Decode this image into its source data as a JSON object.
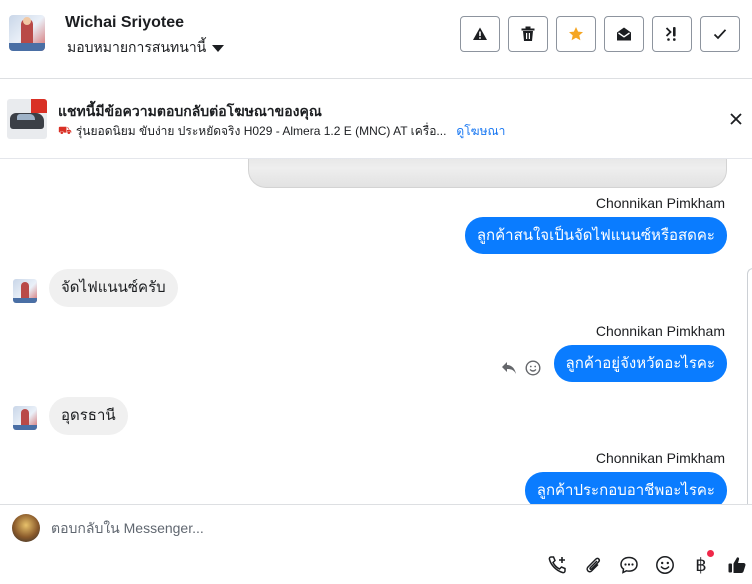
{
  "header": {
    "contact_name": "Wichai Sriyotee",
    "assign_label": "มอบหมายการสนทนานี้",
    "toolbar": [
      {
        "name": "report-spam-button",
        "icon": "warning-icon"
      },
      {
        "name": "delete-button",
        "icon": "trash-icon"
      },
      {
        "name": "star-button",
        "icon": "star-icon"
      },
      {
        "name": "mark-unread-button",
        "icon": "envelope-open-icon"
      },
      {
        "name": "follow-up-button",
        "icon": "follow-up-icon"
      },
      {
        "name": "done-button",
        "icon": "check-icon"
      }
    ],
    "accent_star": "#f5a623"
  },
  "ad_banner": {
    "title": "แชทนี้มีข้อความตอบกลับต่อโฆษณาของคุณ",
    "subtitle": "รุ่นยอดนิยม ขับง่าย ประหยัดจริง H029 - Almera 1.2 E (MNC) AT เครื่อ...",
    "link": "ดูโฆษณา"
  },
  "messages": [
    {
      "sender": "Chonnikan Pimkham",
      "text": "ลูกค้าสนใจเป็นจัดไฟแนนซ์หรือสดคะ",
      "direction": "out"
    },
    {
      "text": "จัดไฟแนนซ์ครับ",
      "direction": "in"
    },
    {
      "sender": "Chonnikan Pimkham",
      "text": "ลูกค้าอยู่จังหวัดอะไรคะ",
      "direction": "out"
    },
    {
      "text": "อุดรธานี",
      "direction": "in"
    },
    {
      "sender": "Chonnikan Pimkham",
      "text": "ลูกค้าประกอบอาชีพอะไรคะ",
      "direction": "out"
    }
  ],
  "composer": {
    "placeholder": "ตอบกลับใน Messenger...",
    "baht_symbol": "฿",
    "tools": [
      "add-call-icon",
      "attachment-icon",
      "saved-reply-icon",
      "emoji-icon",
      "payment-icon",
      "thumbs-up-icon"
    ]
  },
  "colors": {
    "outgoing_bubble": "#0a7cff",
    "incoming_bubble": "#f0f0f0",
    "link": "#1877f2"
  }
}
